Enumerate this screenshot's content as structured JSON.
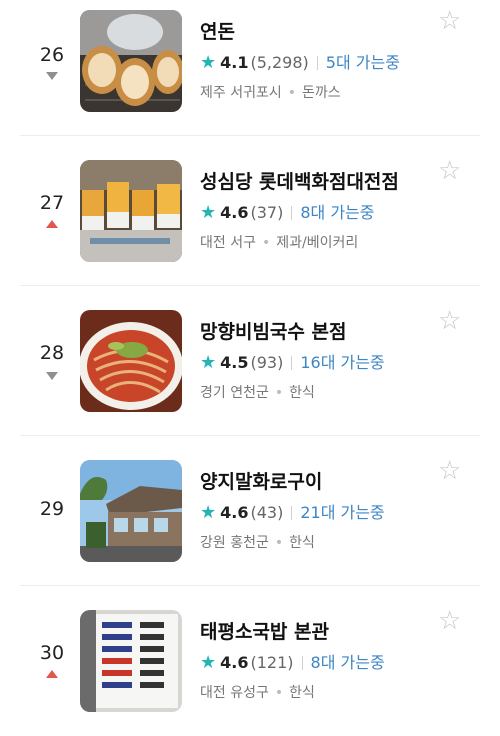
{
  "colors": {
    "star": "#23b5b5",
    "visitors": "#3d86c6",
    "trend_up": "#e2574c",
    "trend_down": "#8f8f8f"
  },
  "restaurants": [
    {
      "rank": "26",
      "trend": "down",
      "name": "연돈",
      "score": "4.1",
      "reviews": "(5,298)",
      "visitors": "5대 가는중",
      "region": "제주 서귀포시",
      "category": "돈까스",
      "image": "tonkatsu-photo"
    },
    {
      "rank": "27",
      "trend": "up",
      "name": "성심당 롯데백화점대전점",
      "score": "4.6",
      "reviews": "(37)",
      "visitors": "8대 가는중",
      "region": "대전 서구",
      "category": "제과/베이커리",
      "image": "bakery-photo"
    },
    {
      "rank": "28",
      "trend": "down",
      "name": "망향비빔국수 본점",
      "score": "4.5",
      "reviews": "(93)",
      "visitors": "16대 가는중",
      "region": "경기 연천군",
      "category": "한식",
      "image": "noodle-photo"
    },
    {
      "rank": "29",
      "trend": "none",
      "name": "양지말화로구이",
      "score": "4.6",
      "reviews": "(43)",
      "visitors": "21대 가는중",
      "region": "강원 홍천군",
      "category": "한식",
      "image": "building-photo"
    },
    {
      "rank": "30",
      "trend": "up",
      "name": "태평소국밥 본관",
      "score": "4.6",
      "reviews": "(121)",
      "visitors": "8대 가는중",
      "region": "대전 유성구",
      "category": "한식",
      "image": "menu-board-photo"
    }
  ]
}
